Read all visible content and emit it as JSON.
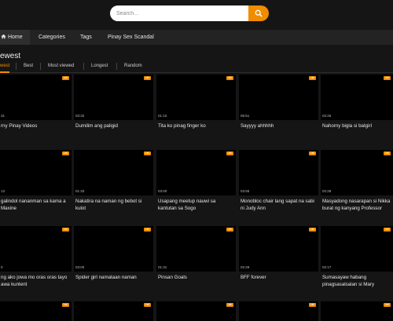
{
  "search": {
    "placeholder": "Search..."
  },
  "nav": [
    {
      "label": "Home",
      "icon": "home-icon"
    },
    {
      "label": "Categories"
    },
    {
      "label": "Tags"
    },
    {
      "label": "Pinay Sex Scandal"
    }
  ],
  "heading": "ewest",
  "filters": [
    {
      "label": "west",
      "active": true
    },
    {
      "label": "Best"
    },
    {
      "label": "Most viewed"
    },
    {
      "label": "Longest"
    },
    {
      "label": "Random"
    }
  ],
  "badge": "HD",
  "accent_color": "#f08c00",
  "videos": [
    {
      "duration": "31",
      "title": "rny Pinay Videos"
    },
    {
      "duration": "03:32",
      "title": "Dumilim ang paligid"
    },
    {
      "duration": "01:10",
      "title": "Tita ko pinag finger ko"
    },
    {
      "duration": "05:51",
      "title": "Sayyyy ahhhhh"
    },
    {
      "duration": "02:25",
      "title": "Nahorny bigla si batgirl"
    },
    {
      "duration": "13",
      "title": "galindol nananman sa kama a Maxine"
    },
    {
      "duration": "01:33",
      "title": "Nakatira na naman ng bebot si kulot"
    },
    {
      "duration": "03:00",
      "title": "Usapang meetup nauwi sa kantutan sa Sogo"
    },
    {
      "duration": "03:55",
      "title": "Monobloc chair lang sapat na sabi ni Judy Ann"
    },
    {
      "duration": "02:28",
      "title": "Masyadong nasarapan si Nikka burat ng kanyang Professor"
    },
    {
      "duration": "0",
      "title": "ng ako jowa mo oras oras tayo awa kuntent"
    },
    {
      "duration": "03:00",
      "title": "Spider girl namataan naman"
    },
    {
      "duration": "01:31",
      "title": "Pinsan Goals"
    },
    {
      "duration": "02:29",
      "title": "BFF forever"
    },
    {
      "duration": "02:17",
      "title": "Sumasayaw habang pinagsasalsalan si Mary"
    }
  ]
}
